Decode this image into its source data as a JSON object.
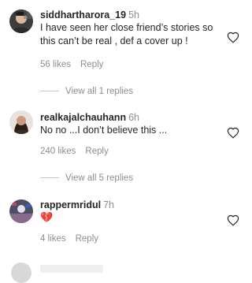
{
  "comments": [
    {
      "username": "siddhartharora_19",
      "time": "5h",
      "text": "I have seen her close friend’s stories so this can’t be real , def a cover up !",
      "likes": "56 likes",
      "reply": "Reply",
      "view_replies": "View all 1 replies",
      "avatar_icon": "avatar-photo-siddhartharora"
    },
    {
      "username": "realkajalchauhann",
      "time": "6h",
      "text": "No no ...I don’t believe this ...",
      "likes": "240 likes",
      "reply": "Reply",
      "view_replies": "View all 5 replies",
      "avatar_icon": "avatar-photo-realkajalchauhann"
    },
    {
      "username": "rappermridul",
      "time": "7h",
      "text": "💔",
      "likes": "4 likes",
      "reply": "Reply",
      "avatar_icon": "avatar-photo-rappermridul"
    }
  ],
  "icons": {
    "like": "heart-outline-icon",
    "emoji": "broken-heart-emoji"
  },
  "colors": {
    "primary_text": "#262626",
    "secondary_text": "#8e8e8e",
    "heart_stroke": "#262626",
    "broken_heart": "#e8486b"
  }
}
